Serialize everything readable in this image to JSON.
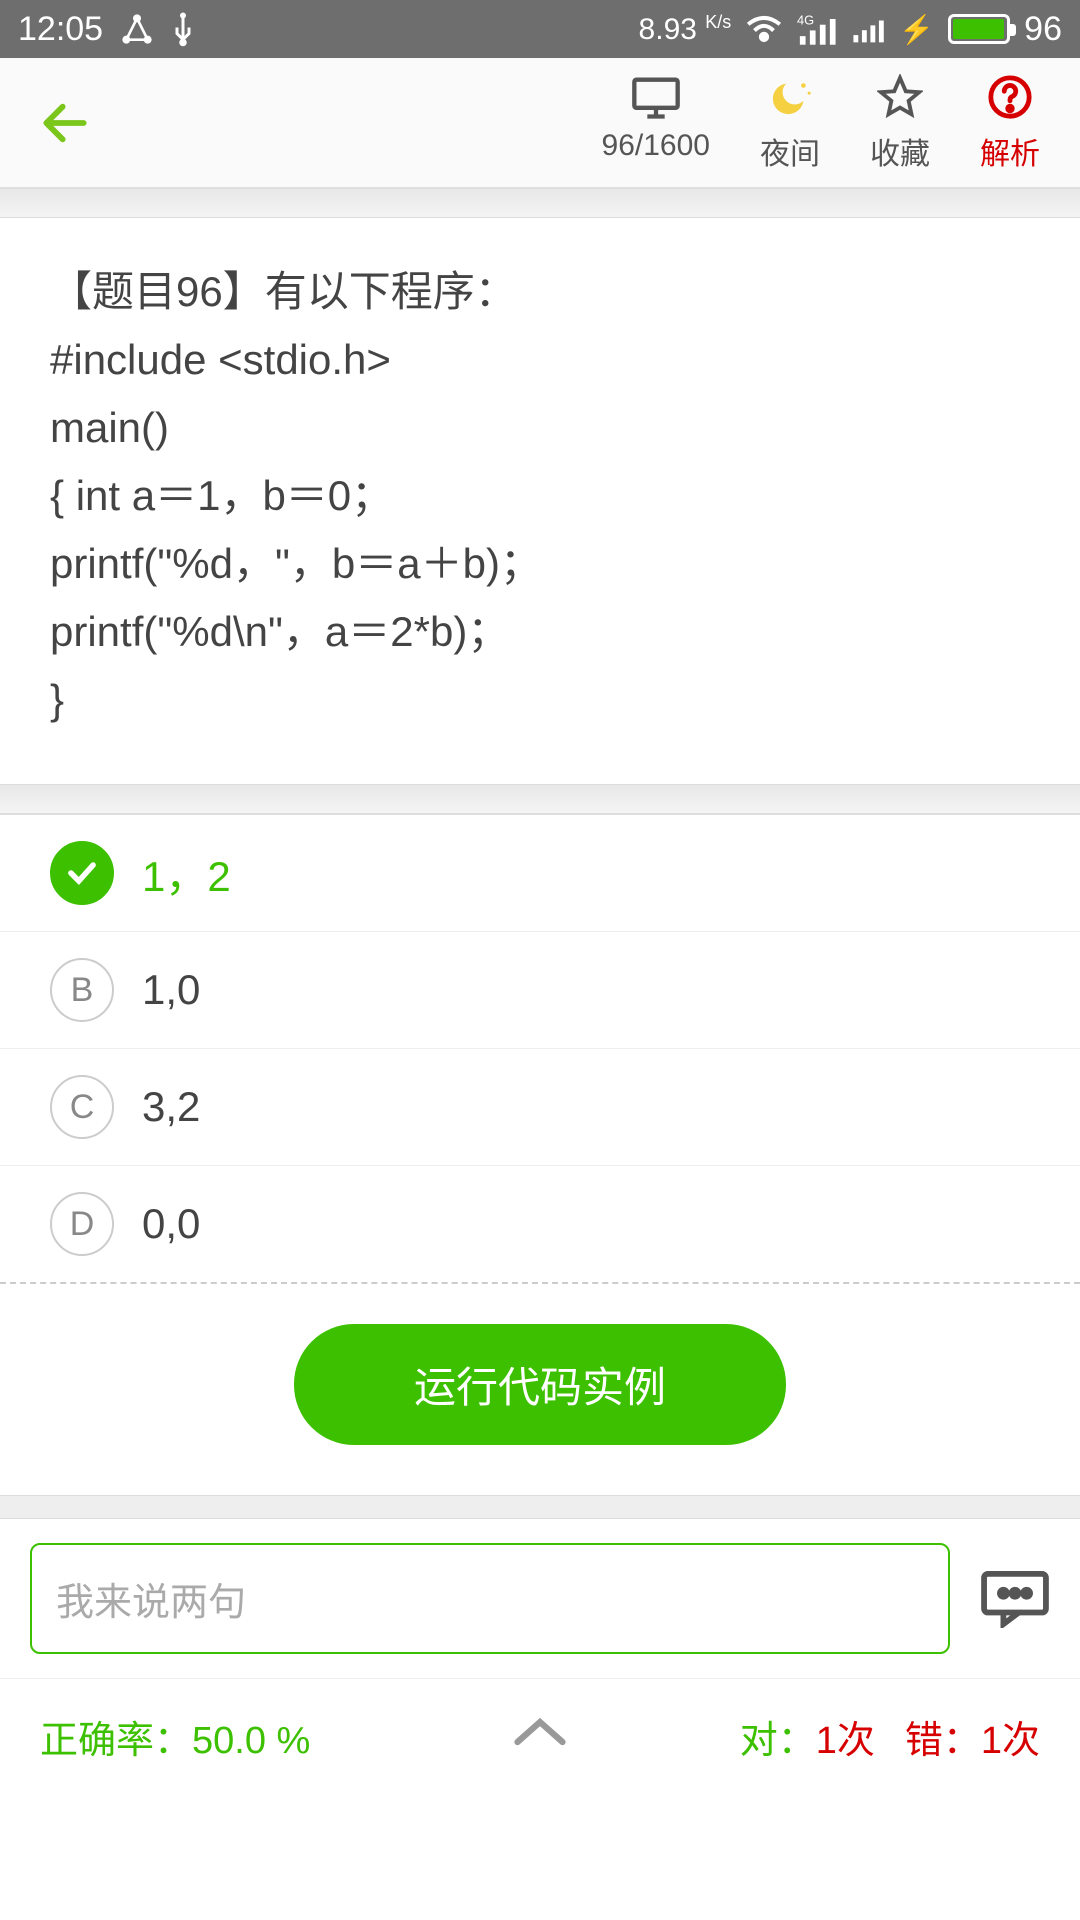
{
  "status": {
    "time": "12:05",
    "speed": "8.93",
    "speed_unit": "K/s",
    "battery": "96"
  },
  "toolbar": {
    "progress": "96/1600",
    "night": "夜间",
    "favorite": "收藏",
    "analysis": "解析"
  },
  "question": {
    "lines": [
      "【题目96】有以下程序：",
      "#include  <stdio.h>",
      "main()",
      "{    int  a＝1，b＝0；",
      "        printf(\"%d，\"，b＝a＋b)；",
      "        printf(\"%d\\n\"，a＝2*b)；",
      "}"
    ]
  },
  "options": [
    {
      "key": "✓",
      "text": "1，2",
      "correct": true
    },
    {
      "key": "B",
      "text": "1,0",
      "correct": false
    },
    {
      "key": "C",
      "text": "3,2",
      "correct": false
    },
    {
      "key": "D",
      "text": "0,0",
      "correct": false
    }
  ],
  "run_label": "运行代码实例",
  "comment_placeholder": "我来说两句",
  "stats": {
    "rate_label": "正确率：",
    "rate_value": "50.0 %",
    "correct_label": "对：",
    "correct_value": "1次",
    "wrong_label": "错：",
    "wrong_value": "1次"
  }
}
